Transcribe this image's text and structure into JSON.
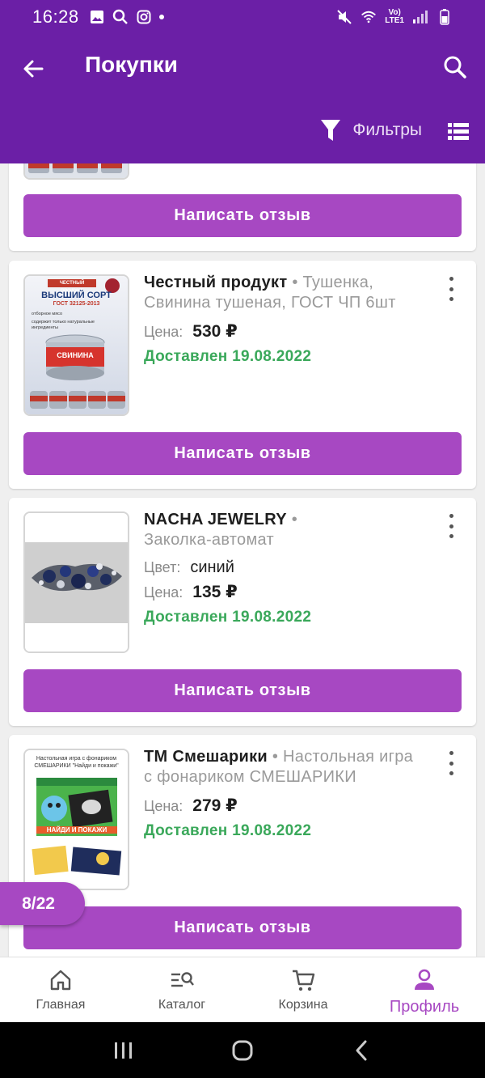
{
  "status_bar": {
    "time": "16:28",
    "lte_top": "Vo)",
    "lte_bottom": "LTE1"
  },
  "header": {
    "title": "Покупки",
    "filters_label": "Фильтры"
  },
  "review_button_label": "Написать отзыв",
  "orders": [
    {
      "brand": "Честный продукт",
      "separator": " • ",
      "product": "Тушенка, Свинина тушеная, ГОСТ ЧП 6шт",
      "thumb_texts": {
        "t1": "ЧЕСТНЫЙ ПРОДУКТ",
        "t2": "ВЫСШИЙ СОРТ",
        "t3": "ГОСТ 32125-2013",
        "b1": "отборное мясо",
        "b2": "содержит только натуральные ингредиенты",
        "can": "СВИНИНА"
      },
      "price_label": "Цена:",
      "price": "530 ₽",
      "status": "Доставлен 19.08.2022"
    },
    {
      "brand": "NACHA JEWELRY",
      "separator": " • ",
      "product": "Заколка-автомат",
      "color_label": "Цвет:",
      "color_value": "синий",
      "price_label": "Цена:",
      "price": "135 ₽",
      "status": "Доставлен 19.08.2022"
    },
    {
      "brand": "ТМ Смешарики",
      "separator": " • ",
      "product": "Настольная игра с фонариком СМЕШАРИКИ",
      "thumb_texts": {
        "caption": "Настольная игра с фонариком СМЕШАРИКИ \"Найди и покажи\"",
        "box": "НАЙДИ И ПОКАЖИ"
      },
      "price_label": "Цена:",
      "price": "279 ₽",
      "status": "Доставлен 19.08.2022"
    }
  ],
  "page_counter": "8/22",
  "bottom_nav": {
    "home": "Главная",
    "catalog": "Каталог",
    "cart": "Корзина",
    "profile": "Профиль"
  },
  "colors": {
    "primary": "#6b1fa6",
    "accent": "#a748c2",
    "delivered": "#3aa85a"
  }
}
